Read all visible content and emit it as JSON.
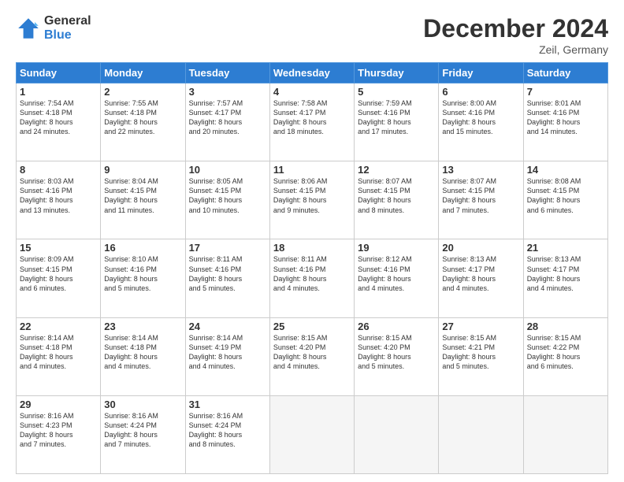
{
  "header": {
    "logo_general": "General",
    "logo_blue": "Blue",
    "month_title": "December 2024",
    "location": "Zeil, Germany"
  },
  "days_of_week": [
    "Sunday",
    "Monday",
    "Tuesday",
    "Wednesday",
    "Thursday",
    "Friday",
    "Saturday"
  ],
  "weeks": [
    [
      {
        "day": "1",
        "lines": [
          "Sunrise: 7:54 AM",
          "Sunset: 4:18 PM",
          "Daylight: 8 hours",
          "and 24 minutes."
        ]
      },
      {
        "day": "2",
        "lines": [
          "Sunrise: 7:55 AM",
          "Sunset: 4:18 PM",
          "Daylight: 8 hours",
          "and 22 minutes."
        ]
      },
      {
        "day": "3",
        "lines": [
          "Sunrise: 7:57 AM",
          "Sunset: 4:17 PM",
          "Daylight: 8 hours",
          "and 20 minutes."
        ]
      },
      {
        "day": "4",
        "lines": [
          "Sunrise: 7:58 AM",
          "Sunset: 4:17 PM",
          "Daylight: 8 hours",
          "and 18 minutes."
        ]
      },
      {
        "day": "5",
        "lines": [
          "Sunrise: 7:59 AM",
          "Sunset: 4:16 PM",
          "Daylight: 8 hours",
          "and 17 minutes."
        ]
      },
      {
        "day": "6",
        "lines": [
          "Sunrise: 8:00 AM",
          "Sunset: 4:16 PM",
          "Daylight: 8 hours",
          "and 15 minutes."
        ]
      },
      {
        "day": "7",
        "lines": [
          "Sunrise: 8:01 AM",
          "Sunset: 4:16 PM",
          "Daylight: 8 hours",
          "and 14 minutes."
        ]
      }
    ],
    [
      {
        "day": "8",
        "lines": [
          "Sunrise: 8:03 AM",
          "Sunset: 4:16 PM",
          "Daylight: 8 hours",
          "and 13 minutes."
        ]
      },
      {
        "day": "9",
        "lines": [
          "Sunrise: 8:04 AM",
          "Sunset: 4:15 PM",
          "Daylight: 8 hours",
          "and 11 minutes."
        ]
      },
      {
        "day": "10",
        "lines": [
          "Sunrise: 8:05 AM",
          "Sunset: 4:15 PM",
          "Daylight: 8 hours",
          "and 10 minutes."
        ]
      },
      {
        "day": "11",
        "lines": [
          "Sunrise: 8:06 AM",
          "Sunset: 4:15 PM",
          "Daylight: 8 hours",
          "and 9 minutes."
        ]
      },
      {
        "day": "12",
        "lines": [
          "Sunrise: 8:07 AM",
          "Sunset: 4:15 PM",
          "Daylight: 8 hours",
          "and 8 minutes."
        ]
      },
      {
        "day": "13",
        "lines": [
          "Sunrise: 8:07 AM",
          "Sunset: 4:15 PM",
          "Daylight: 8 hours",
          "and 7 minutes."
        ]
      },
      {
        "day": "14",
        "lines": [
          "Sunrise: 8:08 AM",
          "Sunset: 4:15 PM",
          "Daylight: 8 hours",
          "and 6 minutes."
        ]
      }
    ],
    [
      {
        "day": "15",
        "lines": [
          "Sunrise: 8:09 AM",
          "Sunset: 4:15 PM",
          "Daylight: 8 hours",
          "and 6 minutes."
        ]
      },
      {
        "day": "16",
        "lines": [
          "Sunrise: 8:10 AM",
          "Sunset: 4:16 PM",
          "Daylight: 8 hours",
          "and 5 minutes."
        ]
      },
      {
        "day": "17",
        "lines": [
          "Sunrise: 8:11 AM",
          "Sunset: 4:16 PM",
          "Daylight: 8 hours",
          "and 5 minutes."
        ]
      },
      {
        "day": "18",
        "lines": [
          "Sunrise: 8:11 AM",
          "Sunset: 4:16 PM",
          "Daylight: 8 hours",
          "and 4 minutes."
        ]
      },
      {
        "day": "19",
        "lines": [
          "Sunrise: 8:12 AM",
          "Sunset: 4:16 PM",
          "Daylight: 8 hours",
          "and 4 minutes."
        ]
      },
      {
        "day": "20",
        "lines": [
          "Sunrise: 8:13 AM",
          "Sunset: 4:17 PM",
          "Daylight: 8 hours",
          "and 4 minutes."
        ]
      },
      {
        "day": "21",
        "lines": [
          "Sunrise: 8:13 AM",
          "Sunset: 4:17 PM",
          "Daylight: 8 hours",
          "and 4 minutes."
        ]
      }
    ],
    [
      {
        "day": "22",
        "lines": [
          "Sunrise: 8:14 AM",
          "Sunset: 4:18 PM",
          "Daylight: 8 hours",
          "and 4 minutes."
        ]
      },
      {
        "day": "23",
        "lines": [
          "Sunrise: 8:14 AM",
          "Sunset: 4:18 PM",
          "Daylight: 8 hours",
          "and 4 minutes."
        ]
      },
      {
        "day": "24",
        "lines": [
          "Sunrise: 8:14 AM",
          "Sunset: 4:19 PM",
          "Daylight: 8 hours",
          "and 4 minutes."
        ]
      },
      {
        "day": "25",
        "lines": [
          "Sunrise: 8:15 AM",
          "Sunset: 4:20 PM",
          "Daylight: 8 hours",
          "and 4 minutes."
        ]
      },
      {
        "day": "26",
        "lines": [
          "Sunrise: 8:15 AM",
          "Sunset: 4:20 PM",
          "Daylight: 8 hours",
          "and 5 minutes."
        ]
      },
      {
        "day": "27",
        "lines": [
          "Sunrise: 8:15 AM",
          "Sunset: 4:21 PM",
          "Daylight: 8 hours",
          "and 5 minutes."
        ]
      },
      {
        "day": "28",
        "lines": [
          "Sunrise: 8:15 AM",
          "Sunset: 4:22 PM",
          "Daylight: 8 hours",
          "and 6 minutes."
        ]
      }
    ],
    [
      {
        "day": "29",
        "lines": [
          "Sunrise: 8:16 AM",
          "Sunset: 4:23 PM",
          "Daylight: 8 hours",
          "and 7 minutes."
        ]
      },
      {
        "day": "30",
        "lines": [
          "Sunrise: 8:16 AM",
          "Sunset: 4:24 PM",
          "Daylight: 8 hours",
          "and 7 minutes."
        ]
      },
      {
        "day": "31",
        "lines": [
          "Sunrise: 8:16 AM",
          "Sunset: 4:24 PM",
          "Daylight: 8 hours",
          "and 8 minutes."
        ]
      },
      {
        "day": "",
        "lines": []
      },
      {
        "day": "",
        "lines": []
      },
      {
        "day": "",
        "lines": []
      },
      {
        "day": "",
        "lines": []
      }
    ]
  ]
}
